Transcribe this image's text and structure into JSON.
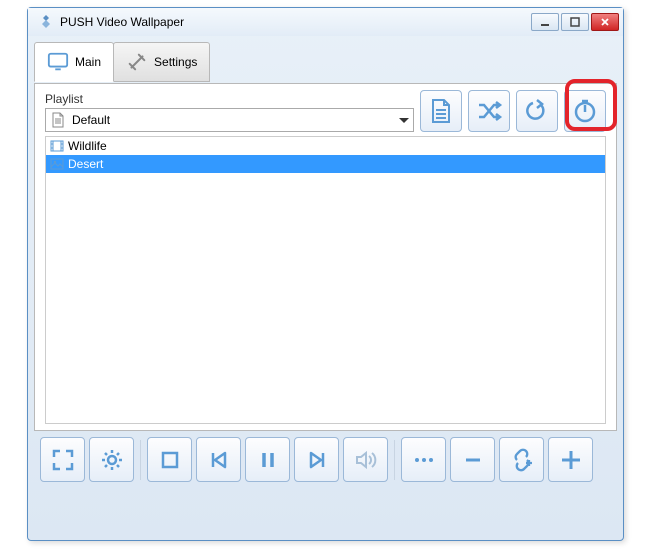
{
  "window": {
    "title": "PUSH Video Wallpaper"
  },
  "tabs": {
    "main": "Main",
    "settings": "Settings"
  },
  "playlist": {
    "label": "Playlist",
    "selected": "Default"
  },
  "items": [
    {
      "name": "Wildlife",
      "type": "video",
      "selected": false
    },
    {
      "name": "Desert",
      "type": "image",
      "selected": true
    }
  ],
  "icons": {
    "document": "document-icon",
    "shuffle": "shuffle-icon",
    "loop": "loop-icon",
    "timer": "timer-icon",
    "fullscreen": "fullscreen-icon",
    "gear": "gear-icon",
    "stop": "stop-icon",
    "prev": "previous-icon",
    "pause": "pause-icon",
    "next": "next-icon",
    "volume": "volume-icon",
    "more": "more-icon",
    "remove": "remove-icon",
    "link": "link-add-icon",
    "add": "add-icon"
  },
  "colors": {
    "accent": "#3399ff",
    "iconstroke": "#5b9bd5",
    "highlight": "#e3242b"
  }
}
